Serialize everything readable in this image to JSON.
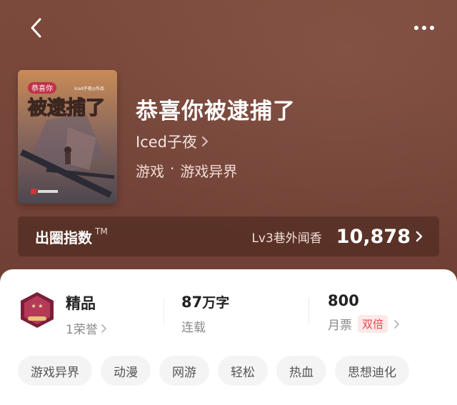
{
  "book": {
    "title": "恭喜你被逮捕了",
    "author": "Iced子夜",
    "genre_main": "游戏",
    "genre_separator": "·",
    "genre_sub": "游戏异界",
    "cover_title": "被逮捕了",
    "cover_badge": "恭喜你",
    "cover_byline": "Iced子夜◎作品"
  },
  "popularity": {
    "label": "出圈指数",
    "tm": "TM",
    "level": "Lv3巷外闻香",
    "value": "10,878"
  },
  "stats": {
    "badge_label": "精品",
    "honor": "1荣誉",
    "words_value": "87",
    "words_unit": "万字",
    "status": "连载",
    "monthly_votes": "800",
    "monthly_label": "月票",
    "double_label": "双倍"
  },
  "tags": [
    "游戏异界",
    "动漫",
    "网游",
    "轻松",
    "热血",
    "思想迪化"
  ],
  "icons": {
    "back": "chevron-left-icon",
    "more": "more-horizontal-icon",
    "chevron": "chevron-right-icon"
  },
  "colors": {
    "hero_bg": "#7a4436",
    "accent_red": "#e5484d",
    "tag_bg": "#f4f4f4"
  }
}
